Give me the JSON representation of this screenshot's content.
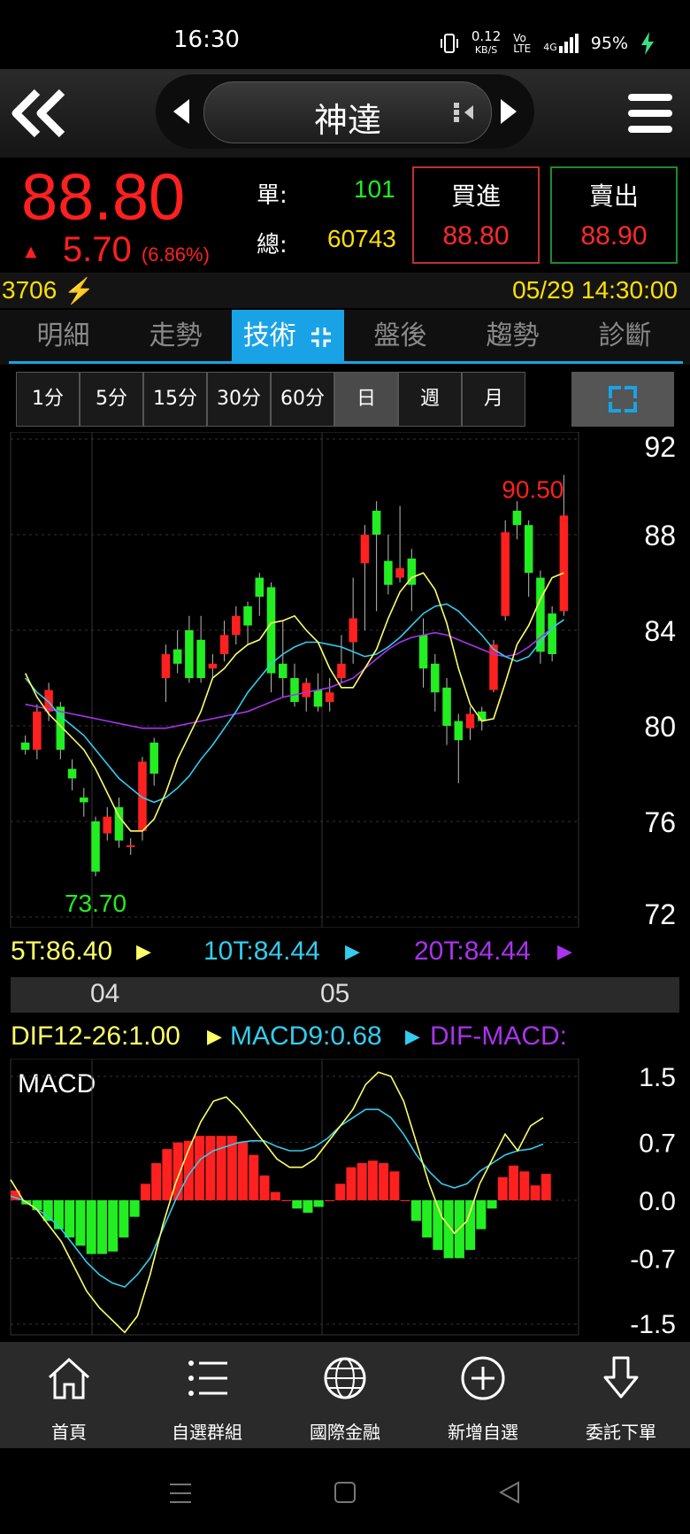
{
  "status": {
    "time": "16:30",
    "speed": "0.12",
    "speed_unit": "KB/S",
    "net": "4G",
    "battery": "95%"
  },
  "header": {
    "stock_name": "神達"
  },
  "quote": {
    "price": "88.80",
    "change": "5.70",
    "change_pct": "(6.86%)",
    "single_label": "單:",
    "single_value": "101",
    "total_label": "總:",
    "total_value": "60743",
    "buy_label": "買進",
    "buy_price": "88.80",
    "sell_label": "賣出",
    "sell_price": "88.90"
  },
  "info": {
    "code": "3706",
    "datetime": "05/29 14:30:00"
  },
  "tabs": [
    "明細",
    "走勢",
    "技術",
    "盤後",
    "趨勢",
    "診斷"
  ],
  "active_tab": "技術",
  "periods": [
    "1分",
    "5分",
    "15分",
    "30分",
    "60分",
    "日",
    "週",
    "月"
  ],
  "selected_period": "日",
  "colors": {
    "up": "#ff2020",
    "down": "#22ee22",
    "ma5": "#ffff66",
    "ma10": "#33ccee",
    "ma20": "#aa33ee",
    "accent": "#19a3e6"
  },
  "chart_data": [
    {
      "type": "candlestick",
      "high_label": "90.50",
      "low_label": "73.70",
      "y_ticks": [
        "92",
        "88",
        "84",
        "80",
        "76",
        "72"
      ],
      "ylim": [
        72,
        92
      ],
      "x_labels": [
        "04",
        "05"
      ],
      "ma_legend": [
        {
          "label": "5T:86.40"
        },
        {
          "label": "10T:84.44"
        },
        {
          "label": "20T:84.44"
        }
      ],
      "candles": [
        [
          79.3,
          79.0,
          79.6,
          78.8
        ],
        [
          79.0,
          80.6,
          80.9,
          78.6
        ],
        [
          80.6,
          81.5,
          81.8,
          80.2
        ],
        [
          80.8,
          79.0,
          81.0,
          78.6
        ],
        [
          78.2,
          77.8,
          78.6,
          77.3
        ],
        [
          77.0,
          76.8,
          77.4,
          76.2
        ],
        [
          76.0,
          73.9,
          76.2,
          73.7
        ],
        [
          75.5,
          76.2,
          76.6,
          75.2
        ],
        [
          76.6,
          75.2,
          77.0,
          74.9
        ],
        [
          75.0,
          75.0,
          75.3,
          74.6
        ],
        [
          75.6,
          78.5,
          78.7,
          75.2
        ],
        [
          79.3,
          78.0,
          79.5,
          77.5
        ],
        [
          82.0,
          83.0,
          83.4,
          81.0
        ],
        [
          83.2,
          82.6,
          84.0,
          82.2
        ],
        [
          84.0,
          82.0,
          84.6,
          81.8
        ],
        [
          83.6,
          82.0,
          84.6,
          81.8
        ],
        [
          82.4,
          82.6,
          83.0,
          82.0
        ],
        [
          83.0,
          83.8,
          84.4,
          82.7
        ],
        [
          83.8,
          84.6,
          85.0,
          83.4
        ],
        [
          85.0,
          84.2,
          85.2,
          83.4
        ],
        [
          86.2,
          85.4,
          86.4,
          84.6
        ],
        [
          85.8,
          82.2,
          86.0,
          81.4
        ],
        [
          82.6,
          82.0,
          84.4,
          81.2
        ],
        [
          82.0,
          81.0,
          82.6,
          80.8
        ],
        [
          81.2,
          81.8,
          82.0,
          80.6
        ],
        [
          81.5,
          80.8,
          82.2,
          80.6
        ],
        [
          81.0,
          81.4,
          82.0,
          80.6
        ],
        [
          82.0,
          82.6,
          83.8,
          81.8
        ],
        [
          83.5,
          84.5,
          86.2,
          82.6
        ],
        [
          86.8,
          88.0,
          88.4,
          84.0
        ],
        [
          89.0,
          88.0,
          89.4,
          84.8
        ],
        [
          86.9,
          85.9,
          88.0,
          85.5
        ],
        [
          86.2,
          86.6,
          89.2,
          86.0
        ],
        [
          87.0,
          85.9,
          87.4,
          84.8
        ],
        [
          83.8,
          82.4,
          84.5,
          81.6
        ],
        [
          82.6,
          81.4,
          83.0,
          80.6
        ],
        [
          81.6,
          80.0,
          82.0,
          79.2
        ],
        [
          80.2,
          79.4,
          80.5,
          77.6
        ],
        [
          79.9,
          80.5,
          80.8,
          79.4
        ],
        [
          80.6,
          80.2,
          80.8,
          79.8
        ],
        [
          81.5,
          83.4,
          83.6,
          81.4
        ],
        [
          84.6,
          88.1,
          88.6,
          84.4
        ],
        [
          89.0,
          88.4,
          89.4,
          87.8
        ],
        [
          88.4,
          86.4,
          88.6,
          85.4
        ],
        [
          86.2,
          83.1,
          86.5,
          82.6
        ],
        [
          84.7,
          83.0,
          85.0,
          82.7
        ],
        [
          84.8,
          88.8,
          90.5,
          84.6
        ]
      ],
      "ma5": [
        82.2,
        81.2,
        80.5,
        80.0,
        79.5,
        79.0,
        78.2,
        77.2,
        76.2,
        75.6,
        75.6,
        76.1,
        77.2,
        78.6,
        79.6,
        80.6,
        82.0,
        82.4,
        83.0,
        83.4,
        83.6,
        84.3,
        84.4,
        84.6,
        84.0,
        83.5,
        82.4,
        81.6,
        81.6,
        82.4,
        83.2,
        84.5,
        85.6,
        86.2,
        86.4,
        85.7,
        84.3,
        82.4,
        80.9,
        80.2,
        80.3,
        81.8,
        83.4,
        84.2,
        85.3,
        86.2,
        86.4
      ],
      "ma10": [
        82.0,
        81.4,
        81.0,
        80.4,
        80.0,
        79.6,
        79.0,
        78.4,
        77.8,
        77.4,
        77.0,
        76.8,
        77.0,
        77.4,
        77.9,
        78.6,
        79.2,
        79.9,
        80.6,
        81.4,
        82.0,
        82.6,
        83.0,
        83.3,
        83.5,
        83.5,
        83.4,
        83.3,
        83.1,
        82.9,
        83.0,
        83.3,
        83.7,
        84.2,
        84.7,
        85.0,
        85.1,
        84.8,
        84.3,
        83.8,
        83.2,
        82.9,
        82.7,
        82.9,
        83.5,
        84.1,
        84.44
      ],
      "ma20": [
        80.9,
        80.8,
        80.7,
        80.6,
        80.5,
        80.4,
        80.3,
        80.2,
        80.1,
        80.0,
        79.9,
        79.9,
        79.9,
        80.0,
        80.1,
        80.2,
        80.3,
        80.4,
        80.5,
        80.6,
        80.8,
        81.0,
        81.2,
        81.3,
        81.4,
        81.5,
        81.6,
        81.8,
        82.0,
        82.4,
        82.8,
        83.2,
        83.5,
        83.7,
        83.8,
        83.9,
        83.8,
        83.6,
        83.4,
        83.2,
        83.0,
        82.9,
        83.0,
        83.3,
        83.7,
        84.1,
        84.44
      ]
    },
    {
      "type": "bar",
      "name": "MACD",
      "y_ticks": [
        "1.5",
        "0.7",
        "0.0",
        "-0.7",
        "-1.5"
      ],
      "ylim": [
        -1.5,
        1.5
      ],
      "legend": [
        {
          "label": "DIF12-26:1.00"
        },
        {
          "label": "MACD9:0.68"
        },
        {
          "label": "DIF-MACD:"
        }
      ],
      "osc": [
        0.12,
        -0.05,
        -0.12,
        -0.25,
        -0.35,
        -0.45,
        -0.55,
        -0.65,
        -0.65,
        -0.62,
        -0.45,
        -0.2,
        0.2,
        0.45,
        0.62,
        0.7,
        0.72,
        0.78,
        0.78,
        0.78,
        0.78,
        0.7,
        0.55,
        0.3,
        0.1,
        0,
        -0.1,
        -0.15,
        -0.08,
        0,
        0.2,
        0.4,
        0.45,
        0.48,
        0.45,
        0.35,
        0,
        -0.25,
        -0.45,
        -0.6,
        -0.7,
        -0.7,
        -0.6,
        -0.35,
        -0.1,
        0.28,
        0.42,
        0.35,
        0.18,
        0.32
      ],
      "dif": [
        0.25,
        0.0,
        -0.1,
        -0.3,
        -0.5,
        -0.8,
        -1.1,
        -1.3,
        -1.45,
        -1.6,
        -1.4,
        -0.9,
        -0.3,
        0.2,
        0.6,
        0.95,
        1.2,
        1.25,
        1.1,
        0.9,
        0.7,
        0.5,
        0.4,
        0.4,
        0.5,
        0.7,
        0.9,
        1.1,
        1.4,
        1.55,
        1.5,
        1.2,
        0.7,
        0.2,
        -0.2,
        -0.4,
        -0.25,
        0.2,
        0.5,
        0.8,
        0.6,
        0.9,
        1.0
      ],
      "macd": [
        0.05,
        0.0,
        -0.1,
        -0.2,
        -0.35,
        -0.55,
        -0.75,
        -0.9,
        -1.0,
        -1.05,
        -0.9,
        -0.7,
        -0.35,
        0.0,
        0.3,
        0.5,
        0.6,
        0.65,
        0.7,
        0.72,
        0.72,
        0.65,
        0.6,
        0.6,
        0.65,
        0.75,
        0.9,
        1.0,
        1.1,
        1.1,
        1.0,
        0.8,
        0.55,
        0.35,
        0.2,
        0.15,
        0.2,
        0.35,
        0.45,
        0.55,
        0.6,
        0.62,
        0.68
      ]
    }
  ],
  "nav": [
    {
      "label": "首頁",
      "icon": "home-icon"
    },
    {
      "label": "自選群組",
      "icon": "list-icon"
    },
    {
      "label": "國際金融",
      "icon": "globe-icon"
    },
    {
      "label": "新增自選",
      "icon": "plus-circle-icon"
    },
    {
      "label": "委託下單",
      "icon": "order-down-icon"
    }
  ]
}
